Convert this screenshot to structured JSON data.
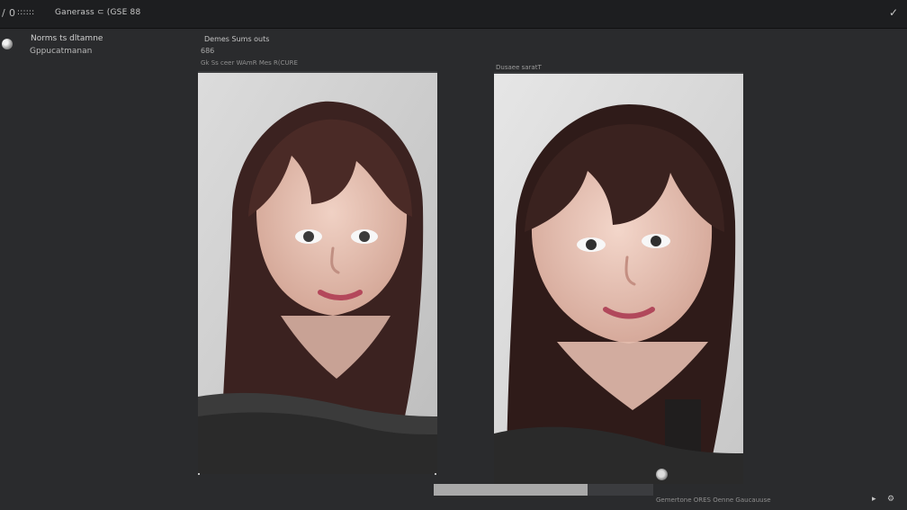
{
  "toolbar": {
    "icon_1": "/",
    "icon_2": "0",
    "label_1": "::::::",
    "title": "Ganerass ⊂ (GSE 88",
    "window_control": "✓"
  },
  "sidebar": {
    "title": "Norms ts dltamne",
    "subtitle": "Gppucatmanan"
  },
  "details": {
    "line_1": "Demes Sums outs",
    "line_2": "686",
    "line_3": "Gk Ss ceer WAmR Mes R(CURE",
    "right_label": "Dusaee saratT"
  },
  "images": {
    "left": {
      "hair_color": "#4a2a26",
      "background": "#cfcfcf"
    },
    "right": {
      "hair_color": "#3a221f",
      "background": "#dedede"
    }
  },
  "progress": {
    "value": 0.7
  },
  "status": {
    "text": "Gemertone ORES Oenne Gaucauuse",
    "icon_left": "▸",
    "icon_right": "⚙"
  }
}
